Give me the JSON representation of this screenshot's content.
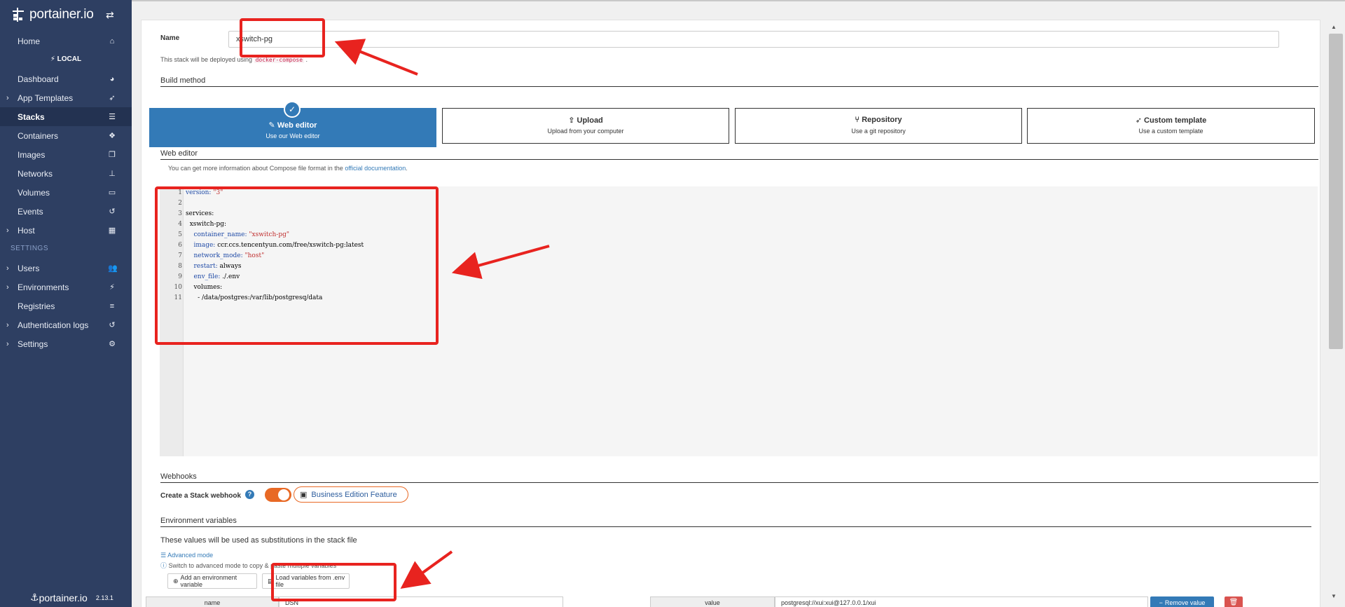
{
  "sidebar": {
    "brand": "portainer.io",
    "local_label": "LOCAL",
    "items": [
      {
        "label": "Home",
        "icon": "home-icon",
        "glyph": "⌂"
      },
      {
        "label": "Dashboard",
        "icon": "tachometer-icon",
        "glyph": "◕"
      },
      {
        "label": "App Templates",
        "icon": "rocket-icon",
        "glyph": "➶"
      },
      {
        "label": "Stacks",
        "icon": "list-icon",
        "glyph": "☰"
      },
      {
        "label": "Containers",
        "icon": "cubes-icon",
        "glyph": "❖"
      },
      {
        "label": "Images",
        "icon": "clone-icon",
        "glyph": "❐"
      },
      {
        "label": "Networks",
        "icon": "sitemap-icon",
        "glyph": "⊥"
      },
      {
        "label": "Volumes",
        "icon": "hdd-icon",
        "glyph": "▭"
      },
      {
        "label": "Events",
        "icon": "history-icon",
        "glyph": "↺"
      },
      {
        "label": "Host",
        "icon": "th-icon",
        "glyph": "▦"
      }
    ],
    "settings_section": "SETTINGS",
    "settings_items": [
      {
        "label": "Users",
        "icon": "users-icon",
        "glyph": "👥"
      },
      {
        "label": "Environments",
        "icon": "plug-icon",
        "glyph": "⚡"
      },
      {
        "label": "Registries",
        "icon": "database-icon",
        "glyph": "≡"
      },
      {
        "label": "Authentication logs",
        "icon": "history-icon",
        "glyph": "↺"
      },
      {
        "label": "Settings",
        "icon": "cogs-icon",
        "glyph": "⚙"
      }
    ],
    "footer_brand": "portainer.io",
    "version": "2.13.1"
  },
  "form": {
    "name_label": "Name",
    "name_value": "xswitch-pg",
    "deploy_note_prefix": "This stack will be deployed using",
    "deploy_note_code": "docker-compose",
    "build_method_title": "Build method",
    "methods": [
      {
        "title": "Web editor",
        "subtitle": "Use our Web editor",
        "icon": "edit-icon",
        "selected": true
      },
      {
        "title": "Upload",
        "subtitle": "Upload from your computer",
        "icon": "upload-icon",
        "selected": false
      },
      {
        "title": "Repository",
        "subtitle": "Use a git repository",
        "icon": "git-icon",
        "selected": false
      },
      {
        "title": "Custom template",
        "subtitle": "Use a custom template",
        "icon": "rocket-icon",
        "selected": false
      }
    ],
    "web_editor_title": "Web editor",
    "editor_info_prefix": "You can get more information about Compose file format in the",
    "editor_info_link": "official documentation",
    "code_lines": [
      "version: \"3\"",
      "",
      "services:",
      "  xswitch-pg:",
      "    container_name: \"xswitch-pg\"",
      "    image: ccr.ccs.tencentyun.com/free/xswitch-pg:latest",
      "    network_mode: \"host\"",
      "    restart: always",
      "    env_file: ./.env",
      "    volumes:",
      "      - /data/postgres:/var/lib/postgresq/data"
    ],
    "webhooks_title": "Webhooks",
    "webhook_label": "Create a Stack webhook",
    "business_feature": "Business Edition Feature",
    "env_title": "Environment variables",
    "env_desc": "These values will be used as substitutions in the stack file",
    "advanced_mode": "Advanced mode",
    "advanced_note": "Switch to advanced mode to copy & paste multiple variables",
    "add_env_button": "Add an environment variable",
    "load_env_button": "Load variables from .env file",
    "kv_name_header": "name",
    "kv_name_value": "DSN",
    "kv_value_header": "value",
    "kv_value_value": "postgresql://xui:xui@127.0.0.1/xui",
    "remove_value_button": "Remove value"
  },
  "colors": {
    "sidebar_bg": "#2e3f62",
    "accent_blue": "#337ab7",
    "annotation_red": "#e8231f",
    "toggle_orange": "#e86925"
  }
}
